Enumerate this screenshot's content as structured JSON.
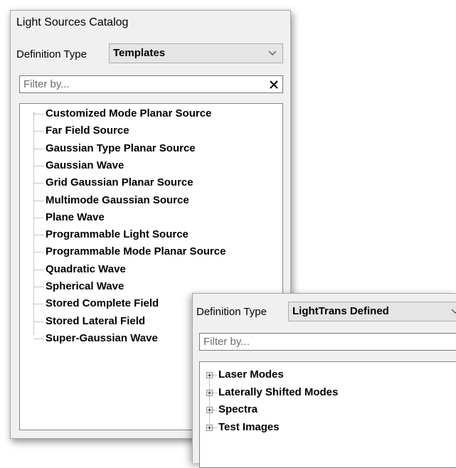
{
  "main_panel": {
    "title": "Light Sources Catalog",
    "definition_type": {
      "label": "Definition Type",
      "selected": "Templates"
    },
    "filter": {
      "placeholder": "Filter by...",
      "value": ""
    },
    "tree_items": [
      "Customized Mode Planar Source",
      "Far Field Source",
      "Gaussian Type Planar Source",
      "Gaussian Wave",
      "Grid Gaussian Planar Source",
      "Multimode Gaussian Source",
      "Plane Wave",
      "Programmable Light Source",
      "Programmable Mode Planar Source",
      "Quadratic Wave",
      "Spherical Wave",
      "Stored Complete Field",
      "Stored Lateral Field",
      "Super-Gaussian Wave"
    ]
  },
  "overlay_panel": {
    "definition_type": {
      "label": "Definition Type",
      "selected": "LightTrans Defined"
    },
    "filter": {
      "placeholder": "Filter by...",
      "value": ""
    },
    "tree_items": [
      "Laser Modes",
      "Laterally Shifted Modes",
      "Spectra",
      "Test Images"
    ]
  }
}
